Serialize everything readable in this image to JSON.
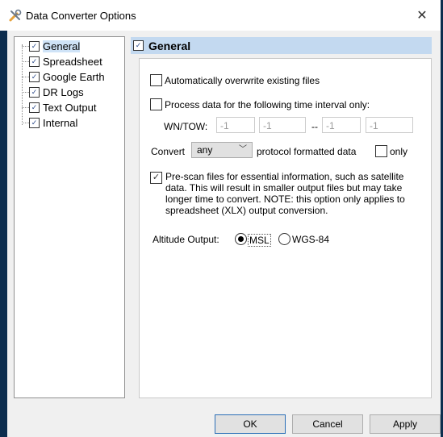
{
  "window": {
    "title": "Data Converter Options",
    "close_glyph": "✕"
  },
  "tree": {
    "items": [
      {
        "label": "General",
        "selected": true
      },
      {
        "label": "Spreadsheet"
      },
      {
        "label": "Google Earth"
      },
      {
        "label": "DR Logs"
      },
      {
        "label": "Text Output"
      },
      {
        "label": "Internal"
      }
    ]
  },
  "panel": {
    "header": "General",
    "overwrite_label": "Automatically overwrite existing files",
    "interval_label": "Process data for the following time interval only:",
    "wn_tow_label": "WN/TOW:",
    "interval_fields": [
      "-1",
      "-1",
      "-1",
      "-1"
    ],
    "interval_separator": "--",
    "convert_label": "Convert",
    "convert_value": "any",
    "protocol_label": "protocol formatted data",
    "only_label": "only",
    "prescan_label": "Pre-scan files for essential information, such as satellite data. This will result in smaller output files but may take longer time to convert. NOTE: this option only applies to spreadsheet (XLX) output conversion.",
    "altitude_label": "Altitude Output:",
    "altitude_options": [
      "MSL",
      "WGS-84"
    ]
  },
  "buttons": {
    "ok": "OK",
    "cancel": "Cancel",
    "apply": "Apply"
  },
  "colors": {
    "desktop": "#0d2d4e",
    "header": "#c3d9f0",
    "selection": "#cfe3f7"
  }
}
